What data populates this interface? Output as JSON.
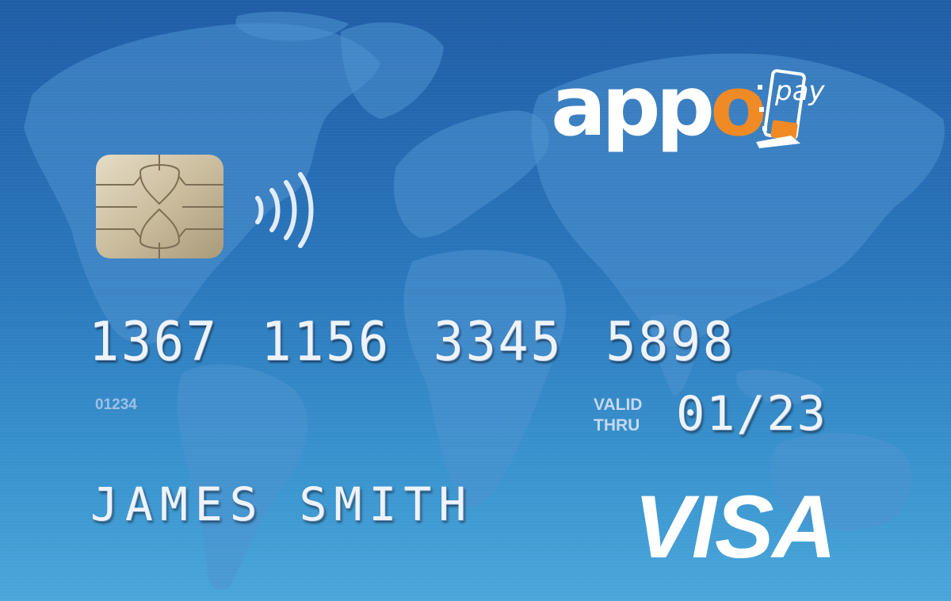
{
  "brand": {
    "word": "app",
    "o": "o",
    "pay": "pay",
    "accent_color": "#f08a24"
  },
  "card": {
    "number_groups": [
      "1367",
      "1156",
      "3345",
      "5898"
    ],
    "small_code": "01234",
    "valid_label_line1": "VALID",
    "valid_label_line2": "THRU",
    "valid_date": "01/23",
    "holder_name": "JAMES SMITH",
    "network": "VISA",
    "background_color": "#2a76bb"
  },
  "icons": {
    "chip": "emv-chip-icon",
    "contactless": "contactless-icon",
    "phone": "phone-icon"
  }
}
